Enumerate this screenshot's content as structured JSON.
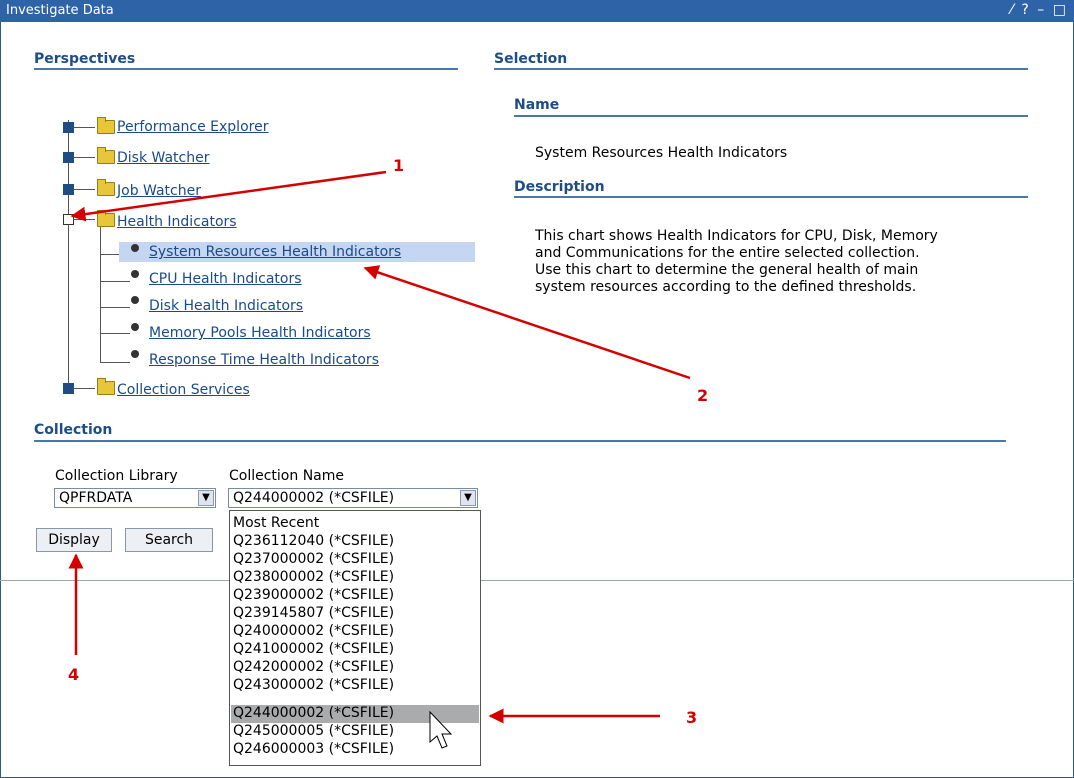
{
  "window": {
    "title": "Investigate Data",
    "controls": "⁄ ? – □"
  },
  "perspectives": {
    "heading": "Perspectives",
    "tree": [
      {
        "label": "Performance Explorer"
      },
      {
        "label": "Disk Watcher"
      },
      {
        "label": "Job Watcher"
      },
      {
        "label": "Health Indicators",
        "children": [
          "System Resources Health Indicators",
          "CPU Health Indicators",
          "Disk Health Indicators",
          "Memory Pools Health Indicators",
          "Response Time Health Indicators"
        ]
      },
      {
        "label": "Collection Services"
      }
    ]
  },
  "selection": {
    "heading": "Selection",
    "name_heading": "Name",
    "name_value": "System Resources Health Indicators",
    "description_heading": "Description",
    "description_lines": [
      "This chart shows Health Indicators for CPU, Disk, Memory",
      "and Communications for the entire selected collection.",
      "Use this chart to determine the general health of main",
      "system resources according to the defined thresholds."
    ]
  },
  "collection": {
    "heading": "Collection",
    "library_label": "Collection Library",
    "library_value": "QPFRDATA",
    "name_label": "Collection Name",
    "name_value": "Q244000002 (*CSFILE)",
    "display_button": "Display",
    "search_button": "Search",
    "options": [
      "Most Recent",
      "Q236112040 (*CSFILE)",
      "Q237000002 (*CSFILE)",
      "Q238000002 (*CSFILE)",
      "Q239000002 (*CSFILE)",
      "Q239145807 (*CSFILE)",
      "Q240000002 (*CSFILE)",
      "Q241000002 (*CSFILE)",
      "Q242000002 (*CSFILE)",
      "Q243000002 (*CSFILE)",
      "Q244000002 (*CSFILE)",
      "Q245000005 (*CSFILE)",
      "Q246000003 (*CSFILE)"
    ],
    "highlighted_option": "Q244000002 (*CSFILE)"
  },
  "annotations": [
    "1",
    "2",
    "3",
    "4"
  ],
  "colors": {
    "accent": "#2f63a7",
    "heading": "#1e4d86",
    "annotation": "#d40000"
  }
}
